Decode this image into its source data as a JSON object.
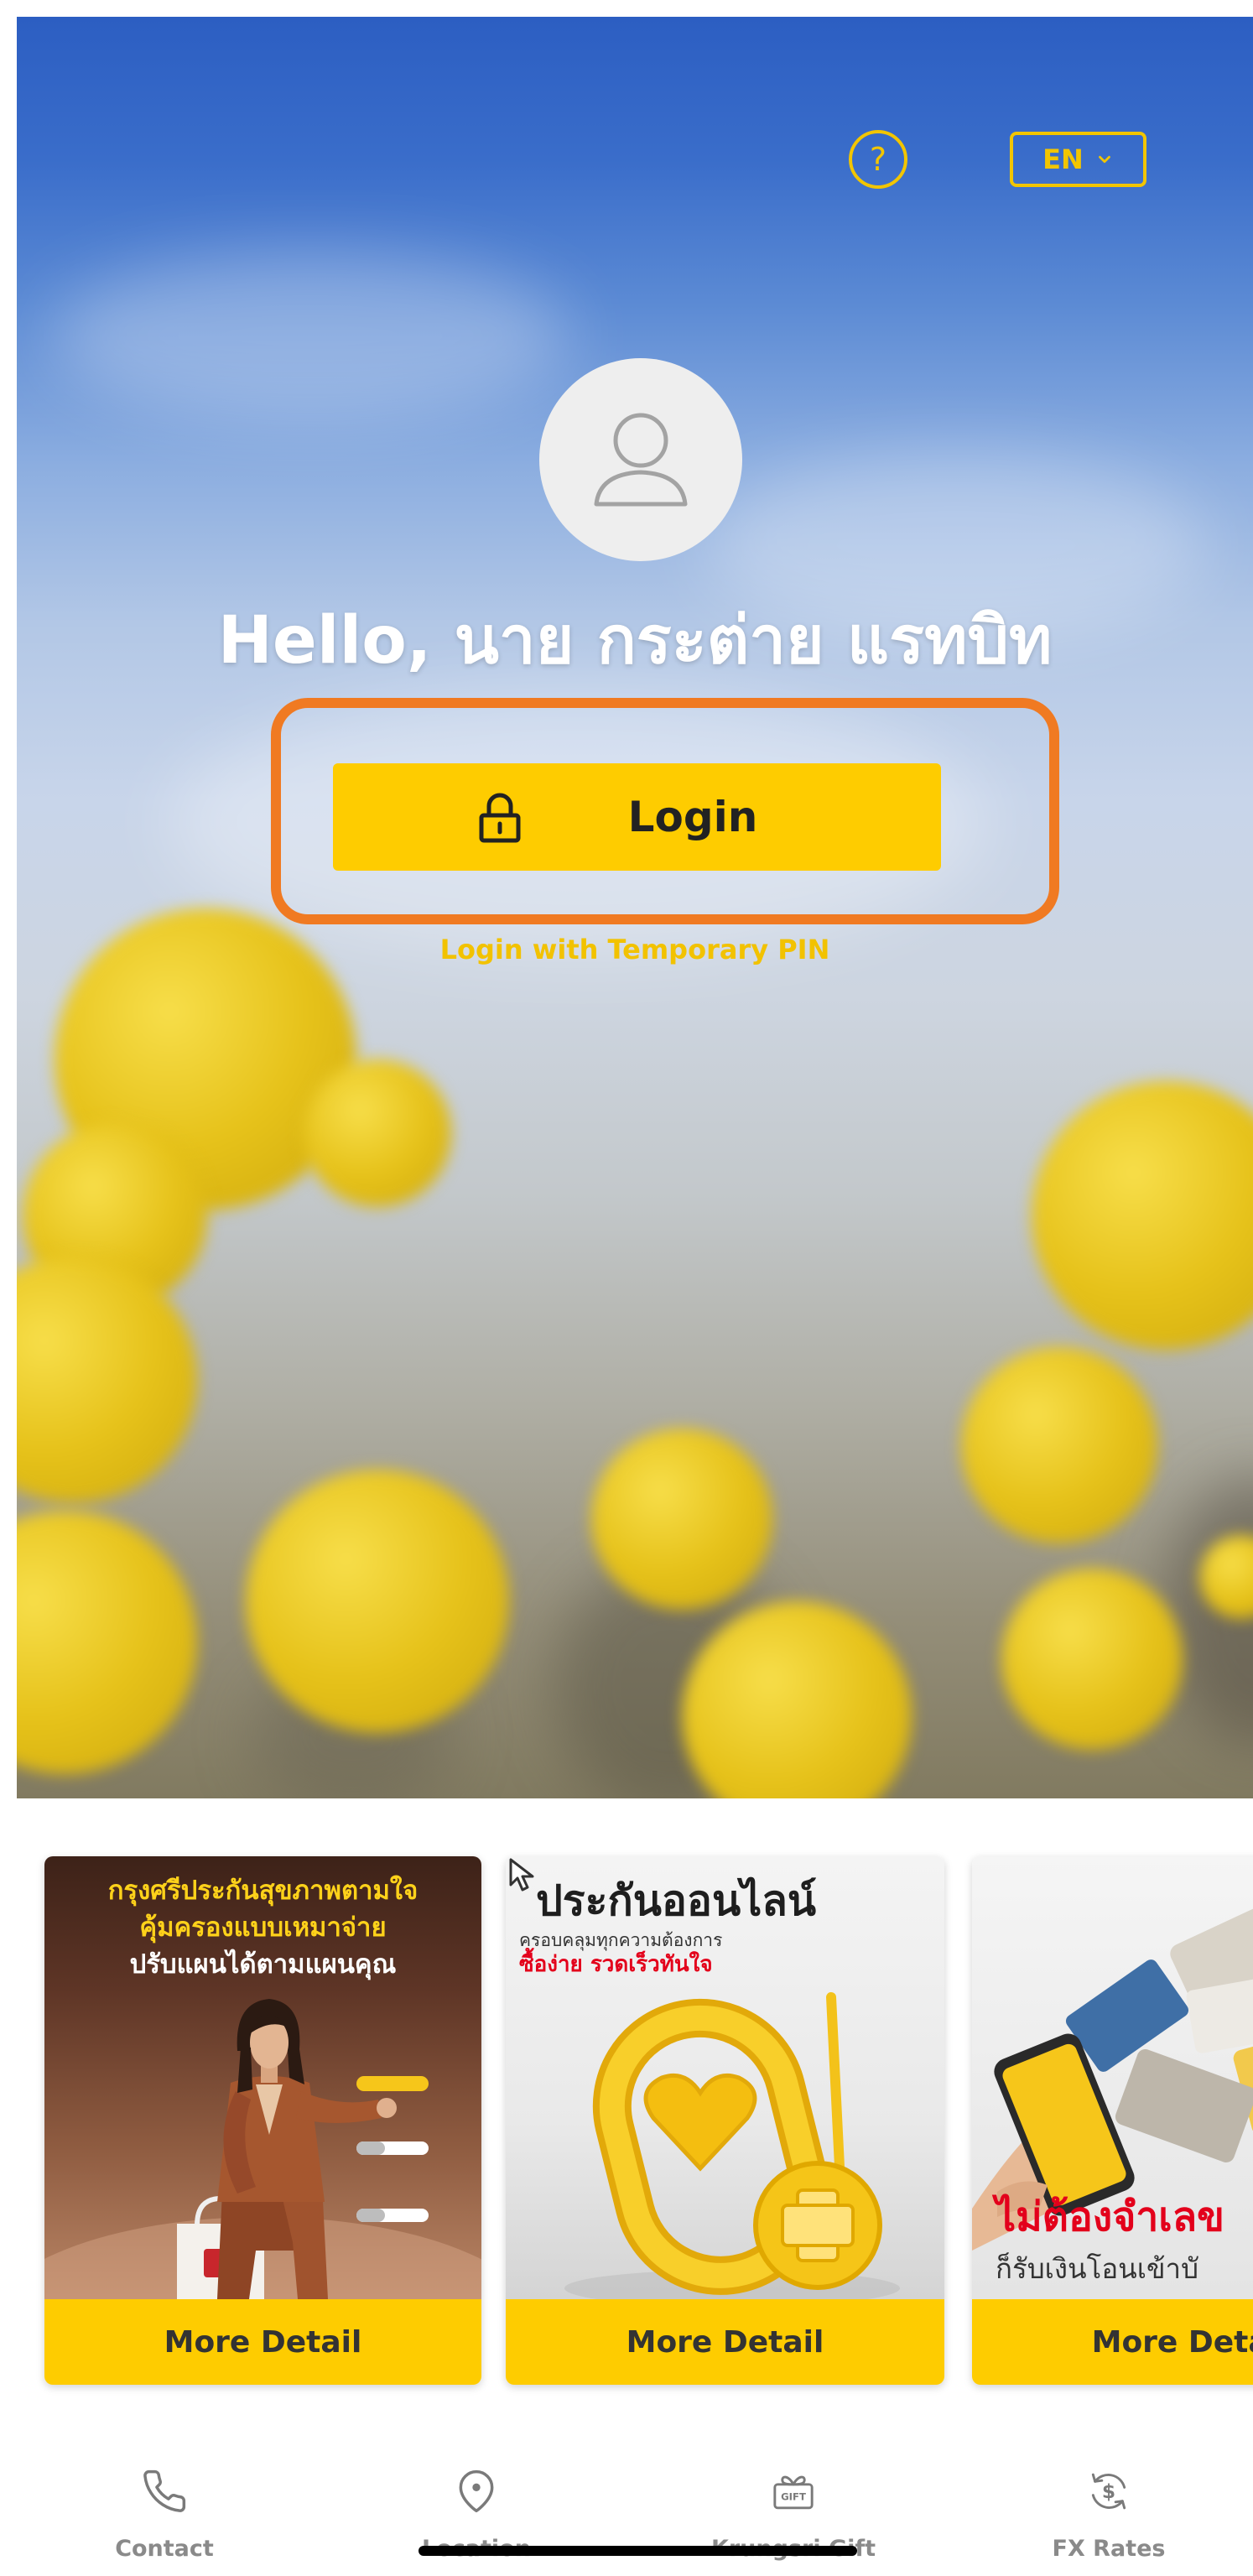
{
  "header": {
    "help_label": "?",
    "help_icon": "question-circle-icon",
    "language_label": "EN",
    "language_icon": "chevron-down-icon"
  },
  "profile": {
    "avatar_icon": "person-icon",
    "greeting": "Hello, นาย กระต่าย แรทบิท"
  },
  "login": {
    "button_label": "Login",
    "button_icon": "lock-icon",
    "temporary_pin_label": "Login with Temporary PIN"
  },
  "promotions": [
    {
      "lines": [
        "กรุงศรีประกันสุขภาพตามใจ",
        "คุ้มครองแบบเหมาจ่าย",
        "ปรับแผนได้ตามแผนคุณ"
      ],
      "button_label": "More Detail"
    },
    {
      "title": "ประกันออนไลน์",
      "subtitle": "ครอบคลุมทุกความต้องการ",
      "tagline": "ซื้อง่าย รวดเร็วทันใจ",
      "button_label": "More Detail"
    },
    {
      "headline": "ไม่ต้องจำเลข",
      "subline": "ก็รับเงินโอนเข้าบั",
      "button_label": "More Detail"
    }
  ],
  "bottom_nav": [
    {
      "label": "Contact",
      "icon": "phone-icon"
    },
    {
      "label": "Location",
      "icon": "location-pin-icon"
    },
    {
      "label": "Krungsri Gift",
      "icon": "gift-icon",
      "icon_text": "GIFT"
    },
    {
      "label": "FX Rates",
      "icon": "currency-exchange-icon",
      "icon_text": "$"
    }
  ],
  "colors": {
    "brand_yellow": "#FECC00",
    "highlight_orange": "#F07A22",
    "greeting_white": "#FFFFFF",
    "nav_gray": "#8A8A8A",
    "promo_red": "#E3001B"
  }
}
